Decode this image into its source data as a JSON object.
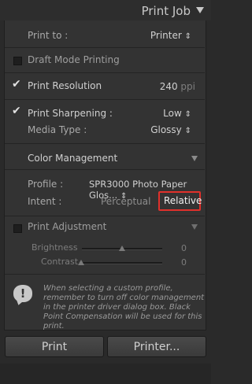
{
  "panel": {
    "title": "Print Job"
  },
  "print_to": {
    "label": "Print to :",
    "value": "Printer",
    "arrow": "⇕"
  },
  "draft_mode": {
    "label": "Draft Mode Printing",
    "checked": false
  },
  "print_resolution": {
    "label": "Print Resolution",
    "checked": true,
    "value": "240",
    "unit": "ppi"
  },
  "print_sharpening": {
    "label": "Print Sharpening :",
    "checked": true,
    "value": "Low",
    "arrow": "⇕"
  },
  "media_type": {
    "label": "Media Type :",
    "value": "Glossy",
    "arrow": "⇕"
  },
  "color_management": {
    "title": "Color Management",
    "profile_label": "Profile :",
    "profile_value": "SPR3000 Photo Paper Glos...",
    "profile_arrow": "⇕",
    "intent_label": "Intent :",
    "intent_perceptual": "Perceptual",
    "intent_relative": "Relative",
    "intent_selected": "Relative"
  },
  "print_adjustment": {
    "title": "Print Adjustment",
    "checked": false,
    "brightness": {
      "label": "Brightness",
      "value": "0"
    },
    "contrast": {
      "label": "Contrast",
      "value": "0"
    }
  },
  "notice": {
    "text": "When selecting a custom profile, remember to turn off color management in the printer driver dialog box. Black Point Compensation will be used for this print."
  },
  "buttons": {
    "print": "Print",
    "printer": "Printer..."
  },
  "colors": {
    "highlight_border": "#e0302b",
    "panel_bg": "#333333"
  }
}
